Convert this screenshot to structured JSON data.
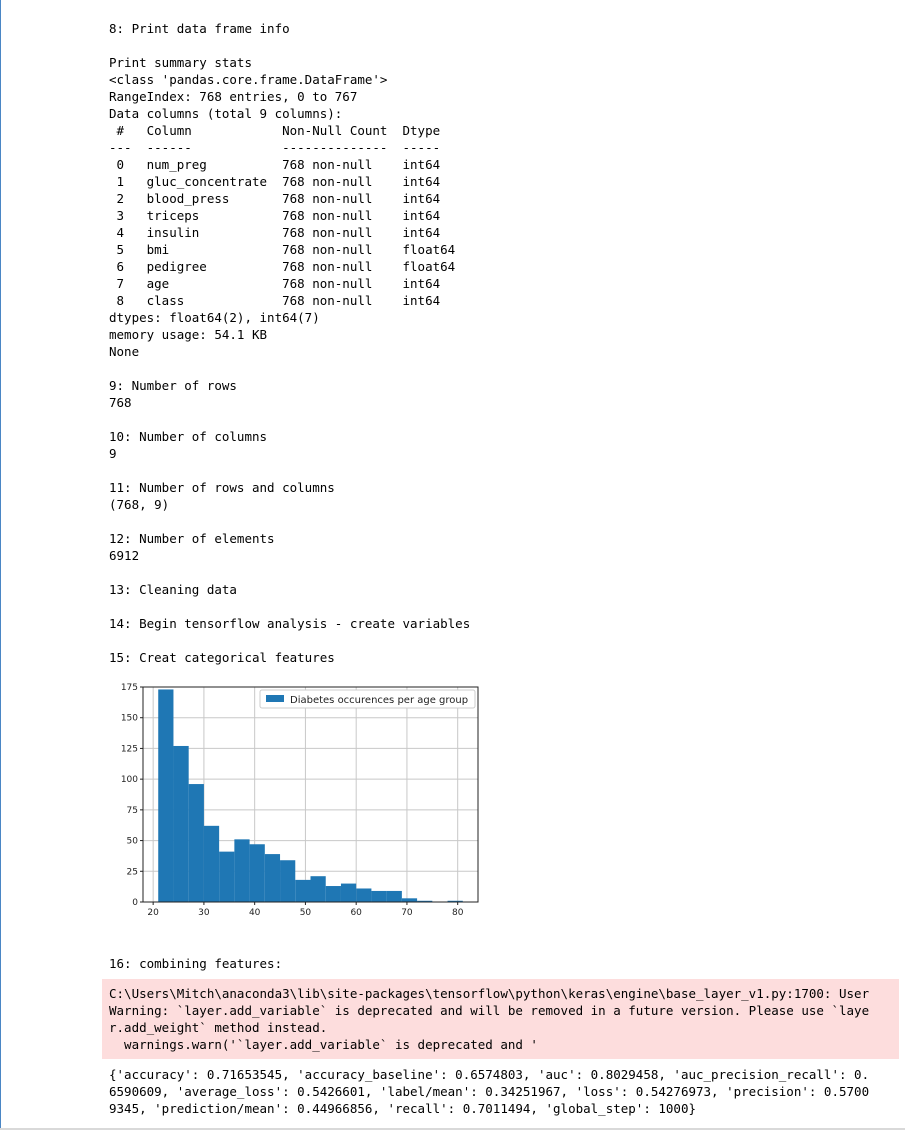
{
  "output": {
    "top_partial": "   ...(partial line)...",
    "section8_title": "8: Print data frame info",
    "summary_block": "Print summary stats\n<class 'pandas.core.frame.DataFrame'>\nRangeIndex: 768 entries, 0 to 767\nData columns (total 9 columns):\n #   Column            Non-Null Count  Dtype  \n---  ------            --------------  -----  \n 0   num_preg          768 non-null    int64  \n 1   gluc_concentrate  768 non-null    int64  \n 2   blood_press       768 non-null    int64  \n 3   triceps           768 non-null    int64  \n 4   insulin           768 non-null    int64  \n 5   bmi               768 non-null    float64\n 6   pedigree          768 non-null    float64\n 7   age               768 non-null    int64  \n 8   class             768 non-null    int64  \ndtypes: float64(2), int64(7)\nmemory usage: 54.1 KB\nNone",
    "section9": "9: Number of rows\n768",
    "section10": "10: Number of columns\n9",
    "section11": "11: Number of rows and columns\n(768, 9)",
    "section12": "12: Number of elements\n6912",
    "section13": "13: Cleaning data",
    "section14": "14: Begin tensorflow analysis - create variables",
    "section15": "15: Creat categorical features",
    "section16": "16: combining features:",
    "warning": "C:\\Users\\Mitch\\anaconda3\\lib\\site-packages\\tensorflow\\python\\keras\\engine\\base_layer_v1.py:1700: User\nWarning: `layer.add_variable` is deprecated and will be removed in a future version. Please use `laye\nr.add_weight` method instead.\n  warnings.warn('`layer.add_variable` is deprecated and '",
    "results": "{'accuracy': 0.71653545, 'accuracy_baseline': 0.6574803, 'auc': 0.8029458, 'auc_precision_recall': 0.\n6590609, 'average_loss': 0.5426601, 'label/mean': 0.34251967, 'loss': 0.54276973, 'precision': 0.5700\n9345, 'prediction/mean': 0.44966856, 'recall': 0.7011494, 'global_step': 1000}"
  },
  "chart_data": {
    "type": "bar",
    "legend": "Diabetes occurences per age group",
    "legend_position": "top-right",
    "bar_color": "#1f77b4",
    "grid": true,
    "xlim": [
      18,
      84
    ],
    "ylim": [
      0,
      175
    ],
    "xticks": [
      "20",
      "30",
      "40",
      "50",
      "60",
      "70",
      "80"
    ],
    "yticks": [
      "0",
      "25",
      "50",
      "75",
      "100",
      "125",
      "150",
      "175"
    ],
    "bins": [
      {
        "x0": 21,
        "x1": 24,
        "count": 173
      },
      {
        "x0": 24,
        "x1": 27,
        "count": 127
      },
      {
        "x0": 27,
        "x1": 30,
        "count": 96
      },
      {
        "x0": 30,
        "x1": 33,
        "count": 62
      },
      {
        "x0": 33,
        "x1": 36,
        "count": 41
      },
      {
        "x0": 36,
        "x1": 39,
        "count": 51
      },
      {
        "x0": 39,
        "x1": 42,
        "count": 47
      },
      {
        "x0": 42,
        "x1": 45,
        "count": 39
      },
      {
        "x0": 45,
        "x1": 48,
        "count": 34
      },
      {
        "x0": 48,
        "x1": 51,
        "count": 18
      },
      {
        "x0": 51,
        "x1": 54,
        "count": 21
      },
      {
        "x0": 54,
        "x1": 57,
        "count": 13
      },
      {
        "x0": 57,
        "x1": 60,
        "count": 15
      },
      {
        "x0": 60,
        "x1": 63,
        "count": 11
      },
      {
        "x0": 63,
        "x1": 66,
        "count": 9
      },
      {
        "x0": 66,
        "x1": 69,
        "count": 9
      },
      {
        "x0": 69,
        "x1": 72,
        "count": 3
      },
      {
        "x0": 72,
        "x1": 75,
        "count": 1
      },
      {
        "x0": 75,
        "x1": 78,
        "count": 0
      },
      {
        "x0": 78,
        "x1": 81,
        "count": 1
      }
    ]
  }
}
